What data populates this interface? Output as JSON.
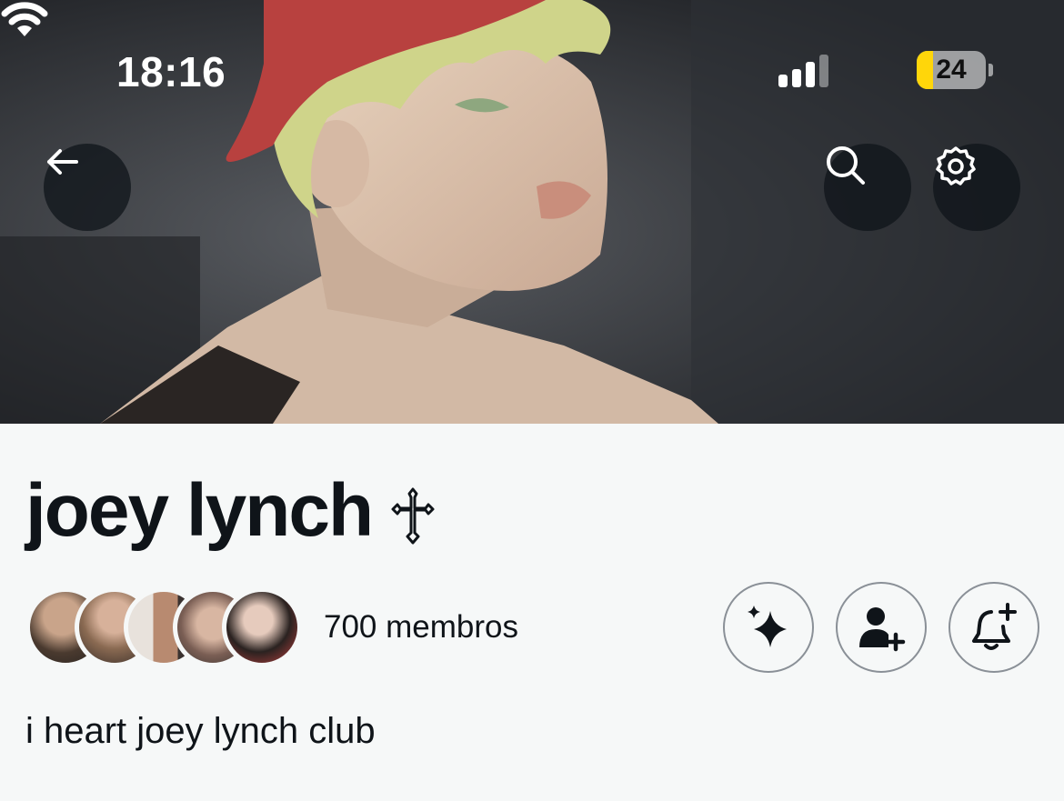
{
  "status_bar": {
    "time": "18:16",
    "battery": "24",
    "battery_level": 0.24,
    "battery_color": "#ffd60a"
  },
  "header": {
    "back_icon": "arrow-left-icon",
    "search_icon": "search-icon",
    "settings_icon": "gear-icon"
  },
  "community": {
    "name": "joey lynch",
    "name_symbol_icon": "cross-icon",
    "members_label": "700 membros",
    "description": "i heart joey lynch club"
  },
  "actions": {
    "sparkle_icon": "sparkle-icon",
    "add_member_icon": "person-add-icon",
    "notifications_icon": "bell-add-icon"
  },
  "colors": {
    "text": "#0f1419",
    "background": "#f6f8f8",
    "button_border": "#8a9097"
  }
}
